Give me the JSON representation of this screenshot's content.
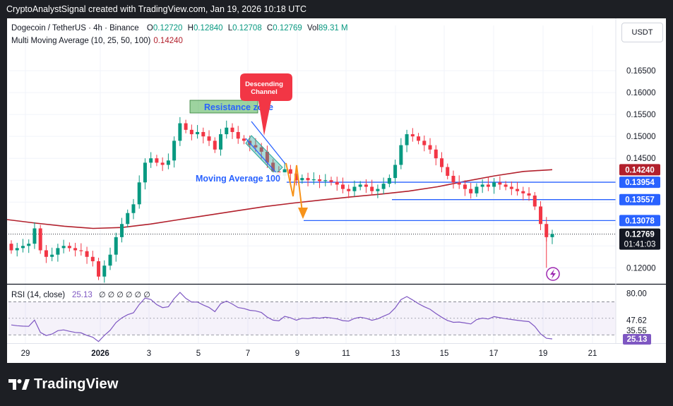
{
  "header": {
    "caption": "CryptoAnalystSignal created with TradingView.com, Jan 19, 2026 10:18 UTC"
  },
  "legend": {
    "symbol": "Dogecoin / TetherUS · 4h · Binance",
    "o_label": "O",
    "o_value": "0.12720",
    "h_label": "H",
    "h_value": "0.12840",
    "l_label": "L",
    "l_value": "0.12708",
    "c_label": "C",
    "c_value": "0.12769",
    "vol_label": "Vol",
    "vol_value": "89.31 M",
    "ma_label": "Multi Moving Average (10, 25, 50, 100)",
    "ma_value": "0.14240"
  },
  "currency_button": "USDT",
  "rsi_legend": {
    "label": "RSI (14, close)",
    "value": "25.13",
    "extra": "∅ ∅ ∅ ∅ ∅ ∅"
  },
  "annotations": {
    "resistance": "Resistance zone",
    "moving_average": "Moving Average 100",
    "descending_line1": "Descending",
    "descending_line2": "Channel"
  },
  "price_axis": {
    "ticks": [
      "0.16500",
      "0.16000",
      "0.15500",
      "0.15000",
      "0.14500",
      "0.12000"
    ],
    "badges": [
      {
        "label": "0.14240",
        "value": 0.1424,
        "color": "#b2202c"
      },
      {
        "label": "0.13954",
        "value": 0.13954,
        "color": "#2962ff"
      },
      {
        "label": "0.13557",
        "value": 0.13557,
        "color": "#2962ff"
      },
      {
        "label": "0.13078",
        "value": 0.13078,
        "color": "#2962ff"
      }
    ],
    "last_price": "0.12769",
    "countdown": "01:41:03"
  },
  "rsi_axis": {
    "ticks": [
      "80.00",
      "47.62",
      "35.55"
    ],
    "last": "25.13",
    "upper_band": 70,
    "lower_band": 30
  },
  "time_axis": {
    "labels": [
      "29",
      "2026",
      "3",
      "5",
      "7",
      "9",
      "11",
      "13",
      "15",
      "17",
      "19",
      "21"
    ]
  },
  "brand": "TradingView",
  "colors": {
    "up": "#089981",
    "down": "#f23645",
    "ma100": "#b2202c",
    "level": "#2962ff",
    "rsi": "#7e57c2",
    "arrow": "#f7931a"
  },
  "chart_data": {
    "type": "candlestick",
    "title": "Dogecoin / TetherUS · 4h · Binance",
    "ylim": [
      0.1165,
      0.1705
    ],
    "x_range_dates": [
      "Dec 29, 2025",
      "Jan 21, 2026"
    ],
    "ohlc_close_path": [
      0.124,
      0.1245,
      0.125,
      0.1255,
      0.129,
      0.124,
      0.1225,
      0.123,
      0.1245,
      0.125,
      0.1245,
      0.124,
      0.1238,
      0.1225,
      0.1215,
      0.118,
      0.1205,
      0.123,
      0.127,
      0.13,
      0.1325,
      0.1345,
      0.1395,
      0.144,
      0.145,
      0.144,
      0.1435,
      0.1445,
      0.149,
      0.153,
      0.1515,
      0.1505,
      0.151,
      0.15,
      0.149,
      0.147,
      0.1505,
      0.152,
      0.151,
      0.1495,
      0.149,
      0.148,
      0.1475,
      0.1465,
      0.144,
      0.142,
      0.141,
      0.1425,
      0.1415,
      0.14,
      0.1405,
      0.14,
      0.1402,
      0.1398,
      0.14,
      0.1396,
      0.139,
      0.138,
      0.1375,
      0.1385,
      0.139,
      0.1385,
      0.1375,
      0.138,
      0.1392,
      0.1405,
      0.1435,
      0.148,
      0.1505,
      0.15,
      0.149,
      0.148,
      0.147,
      0.145,
      0.143,
      0.141,
      0.1395,
      0.139,
      0.138,
      0.137,
      0.1385,
      0.139,
      0.1385,
      0.1395,
      0.139,
      0.1385,
      0.138,
      0.1375,
      0.137,
      0.1365,
      0.134,
      0.13,
      0.127,
      0.1277
    ],
    "series": [
      {
        "name": "Moving Average 100",
        "values": [
          0.131,
          0.1302,
          0.1295,
          0.129,
          0.1292,
          0.13,
          0.131,
          0.132,
          0.133,
          0.134,
          0.1348,
          0.1355,
          0.1362,
          0.1368,
          0.1375,
          0.1385,
          0.1398,
          0.141,
          0.142,
          0.1424
        ]
      }
    ],
    "rsi": {
      "name": "RSI (14, close)",
      "last": 25.13,
      "ylim": [
        20,
        90
      ]
    },
    "levels": [
      0.1424,
      0.13954,
      0.13557,
      0.13078
    ]
  }
}
